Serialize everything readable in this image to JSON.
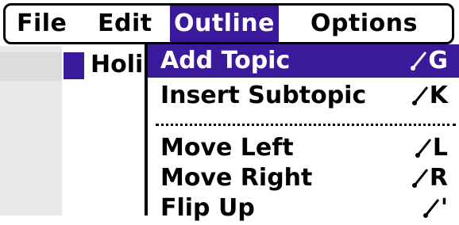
{
  "colors": {
    "accent": "#3a1a9a"
  },
  "menubar": {
    "items": [
      {
        "label": "File"
      },
      {
        "label": "Edit"
      },
      {
        "label": "Outline",
        "active": true
      },
      {
        "label": "Options"
      }
    ]
  },
  "document": {
    "visible_text": "Holi"
  },
  "outline_menu": {
    "items": [
      {
        "label": "Add Topic",
        "shortcut_letter": "G",
        "highlighted": true
      },
      {
        "label": "Insert Subtopic",
        "shortcut_letter": "K"
      },
      {
        "label": "Move Left",
        "shortcut_letter": "L"
      },
      {
        "label": "Move Right",
        "shortcut_letter": "R"
      },
      {
        "label": "Flip Up",
        "shortcut_letter": "'"
      }
    ]
  },
  "icons": {
    "shortcut_stroke": "graffiti-command-stroke-icon"
  }
}
